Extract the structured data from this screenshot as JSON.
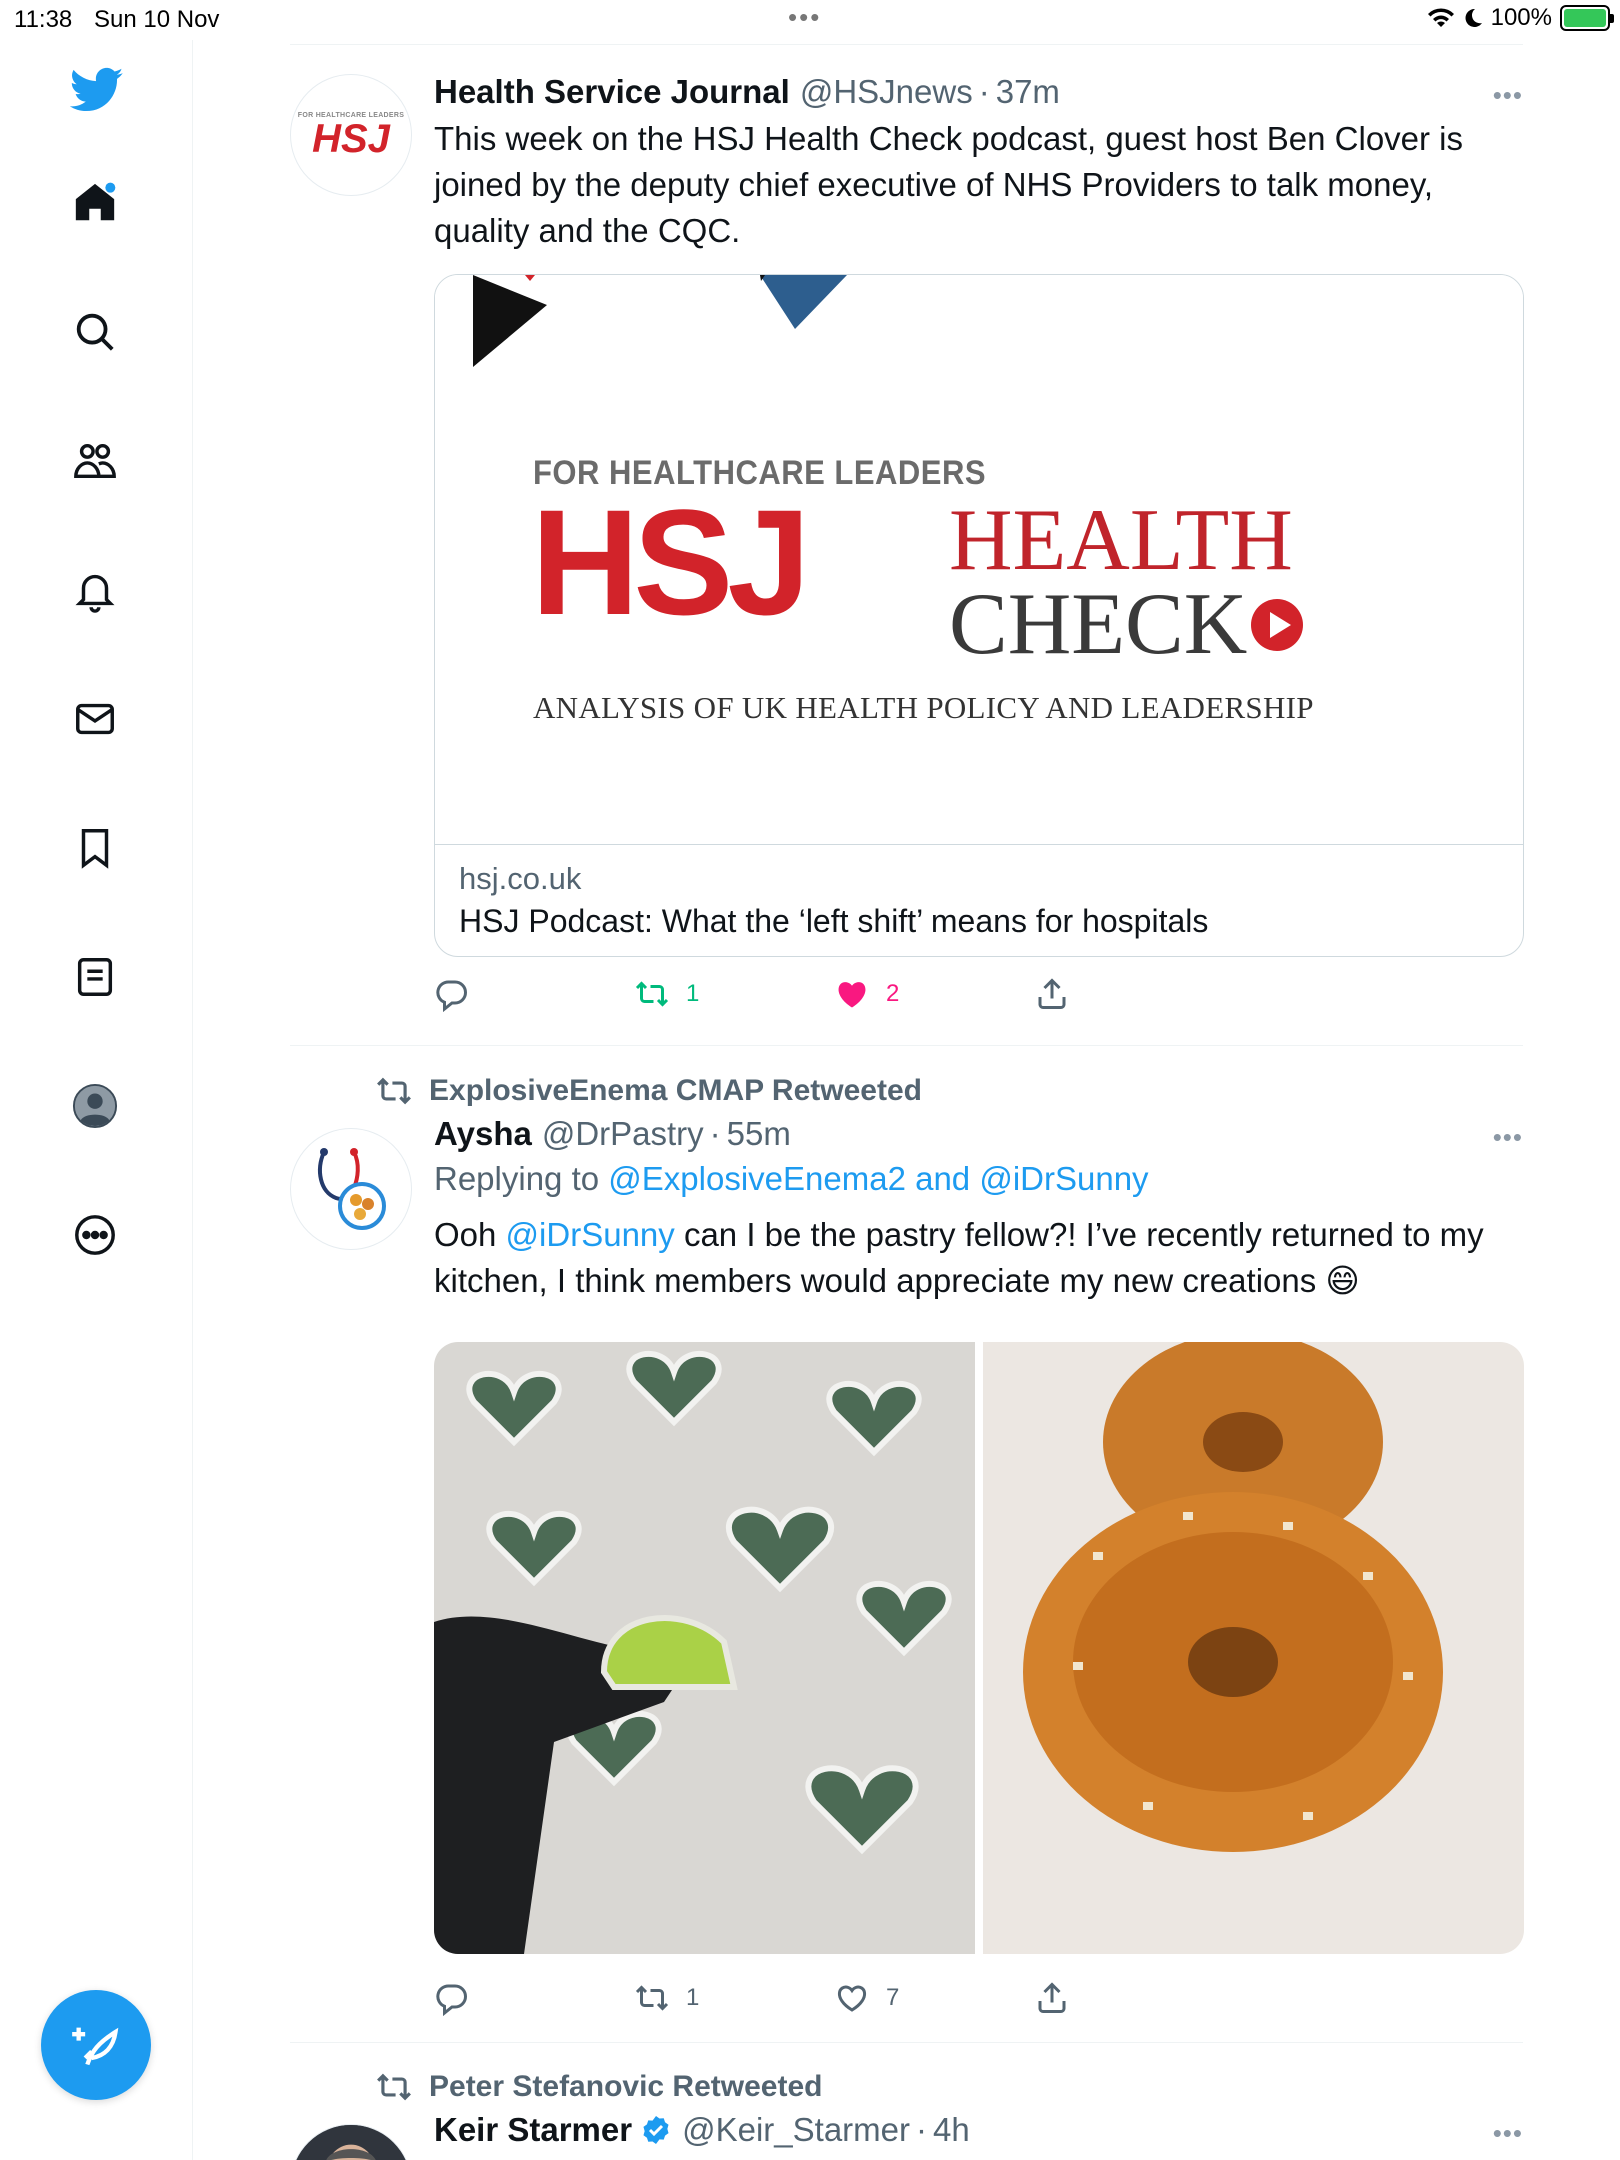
{
  "status_bar": {
    "time": "11:38",
    "date": "Sun 10 Nov",
    "battery": "100%"
  },
  "sidebar": {
    "items": [
      "twitter-logo",
      "home",
      "explore",
      "communities",
      "notifications",
      "messages",
      "bookmarks",
      "lists",
      "profile",
      "more"
    ],
    "compose_label": "+"
  },
  "tweets": [
    {
      "name": "Health Service Journal",
      "handle": "@HSJnews",
      "time": "37m",
      "text": "This week on the HSJ Health Check podcast, guest host Ben Clover is joined by the deputy chief executive of NHS Providers to talk money, quality and the CQC.",
      "avatar_top": "FOR HEALTHCARE LEADERS",
      "avatar_logo": "HSJ",
      "card": {
        "banner_top": "FOR HEALTHCARE LEADERS",
        "banner_logo": "HSJ",
        "banner_health": "HEALTH",
        "banner_check": "CHECK",
        "banner_sub": "ANALYSIS OF UK HEALTH POLICY AND LEADERSHIP",
        "domain": "hsj.co.uk",
        "title": "HSJ Podcast: What the ‘left shift’ means for hospitals"
      },
      "reply_count": "",
      "retweet_count": "1",
      "like_count": "2",
      "liked": true
    },
    {
      "retweeted_by": "ExplosiveEnema CMAP Retweeted",
      "name": "Aysha",
      "handle": "@DrPastry",
      "time": "55m",
      "replying_prefix": "Replying to",
      "replying_to": "@ExplosiveEnema2 and @iDrSunny",
      "text_before": "Ooh",
      "mention": "@iDrSunny",
      "text_after": "can I be the pastry fellow?! I’ve recently returned to my kitchen, I think members would appreciate my new creations 😄",
      "reply_count": "",
      "retweet_count": "1",
      "like_count": "7",
      "liked": false
    },
    {
      "retweeted_by": "Peter Stefanovic Retweeted",
      "name": "Keir Starmer",
      "handle": "@Keir_Starmer",
      "time": "4h",
      "verified": true
    }
  ],
  "colors": {
    "accent": "#1d9bf0",
    "retweet": "#00ba7c",
    "like": "#f91880",
    "muted": "#536471",
    "hsj_red": "#d2232a"
  }
}
